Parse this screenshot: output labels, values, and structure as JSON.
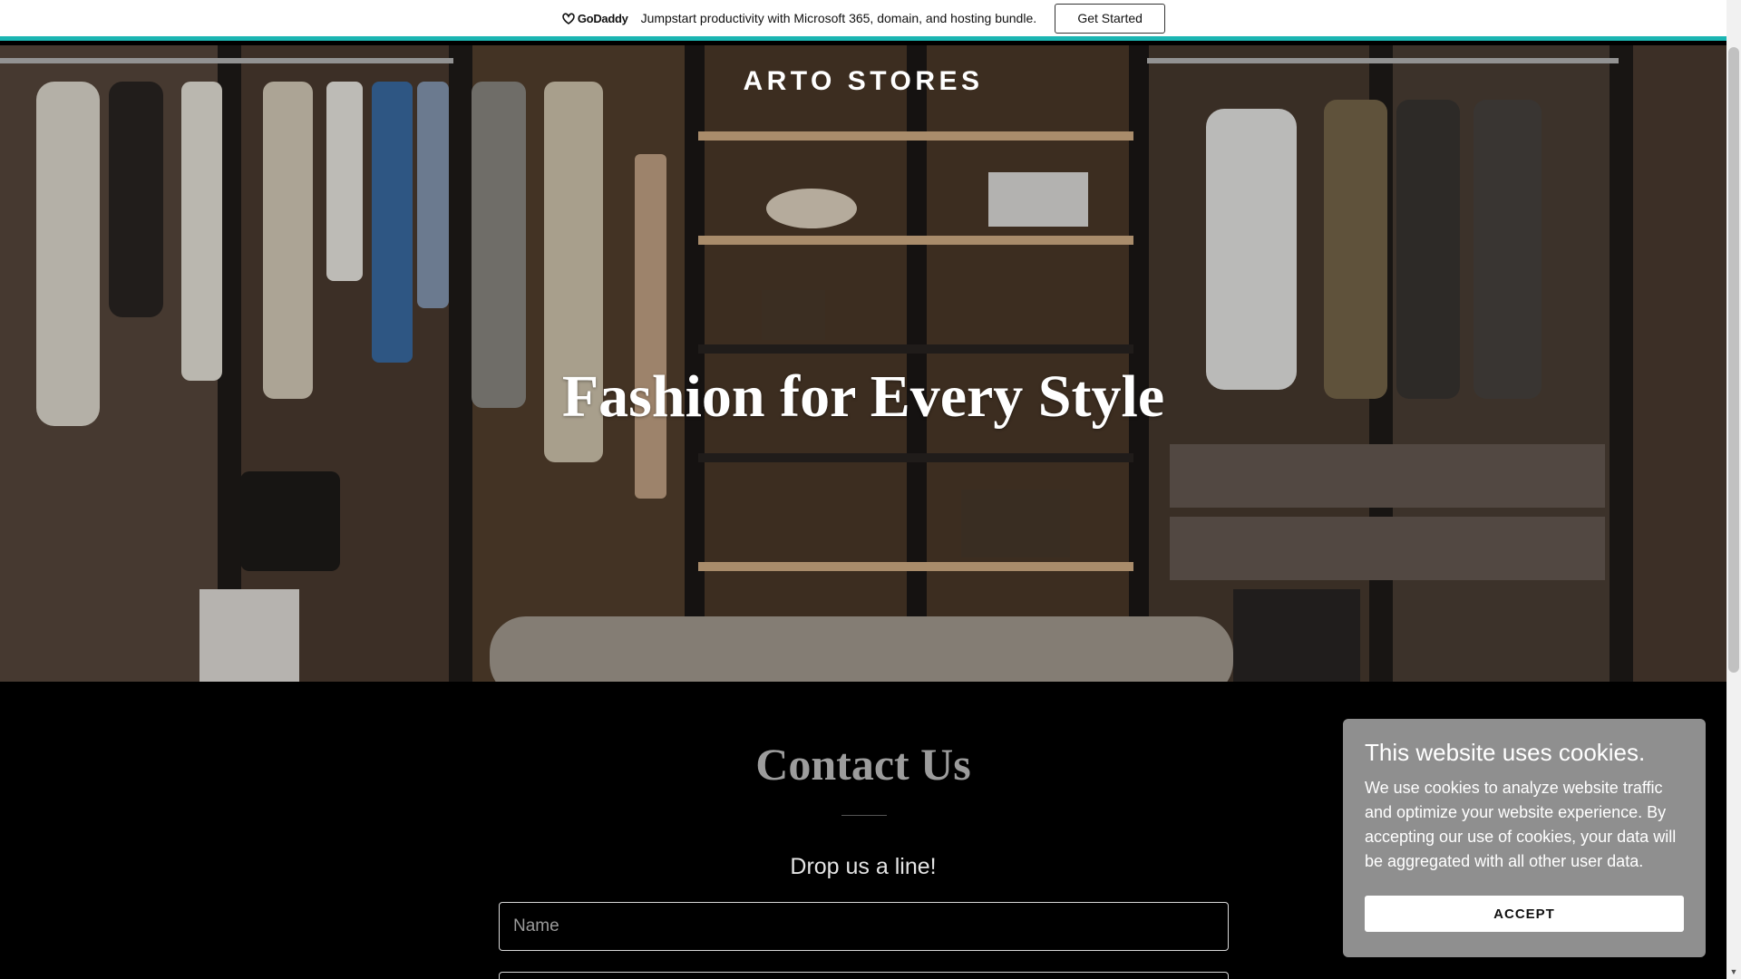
{
  "promo": {
    "logo_text": "GoDaddy",
    "message": "Jumpstart productivity with Microsoft 365, domain, and hosting bundle.",
    "cta_label": "Get Started",
    "accent_color": "#1bb5b2"
  },
  "hero": {
    "brand": "ARTO STORES",
    "title": "Fashion for Every Style"
  },
  "contact": {
    "title": "Contact Us",
    "subtitle": "Drop us a line!",
    "name_placeholder": "Name",
    "email_placeholder": ""
  },
  "cookie_banner": {
    "title": "This website uses cookies.",
    "text": "We use cookies to analyze website traffic and optimize your website experience. By accepting our use of cookies, your data will be aggregated with all other user data.",
    "accept_label": "ACCEPT"
  }
}
